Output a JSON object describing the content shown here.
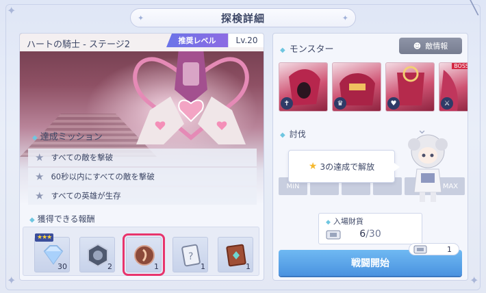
{
  "window": {
    "title": "探検詳細",
    "close_icon": "close-icon"
  },
  "stage": {
    "name": "ハートの騎士 - ステージ2",
    "recommended_label": "推奨レベル",
    "level": "Lv.20"
  },
  "missions": {
    "heading": "達成ミッション",
    "items": [
      "すべての敵を撃破",
      "60秒以内にすべての敵を撃破",
      "すべての英雄が生存"
    ]
  },
  "rewards": {
    "heading": "獲得できる報酬",
    "items": [
      {
        "icon": "diamond-icon",
        "count": "30",
        "stars": "★★★"
      },
      {
        "icon": "badge-crystal-icon",
        "count": "2"
      },
      {
        "icon": "bronze-orb-icon",
        "count": "1",
        "selected": true
      },
      {
        "icon": "mystery-card-icon",
        "count": "1"
      },
      {
        "icon": "skill-book-icon",
        "count": "1"
      }
    ]
  },
  "monsters": {
    "heading": "モンスター",
    "enemy_info_label": "敵情報",
    "boss_label": "BOSS"
  },
  "subjugation": {
    "heading": "討伐",
    "tooltip": "3の達成で解放",
    "min_label": "MIN",
    "max_label": "MAX"
  },
  "entry_fee": {
    "label": "入場財貨",
    "current": "6",
    "max": "30"
  },
  "start": {
    "label": "戦闘開始",
    "cost": "1"
  },
  "colors": {
    "accent_pink": "#e8346c",
    "button_blue": "#4a92e0",
    "level_tag_purple": "#6b74e8"
  }
}
